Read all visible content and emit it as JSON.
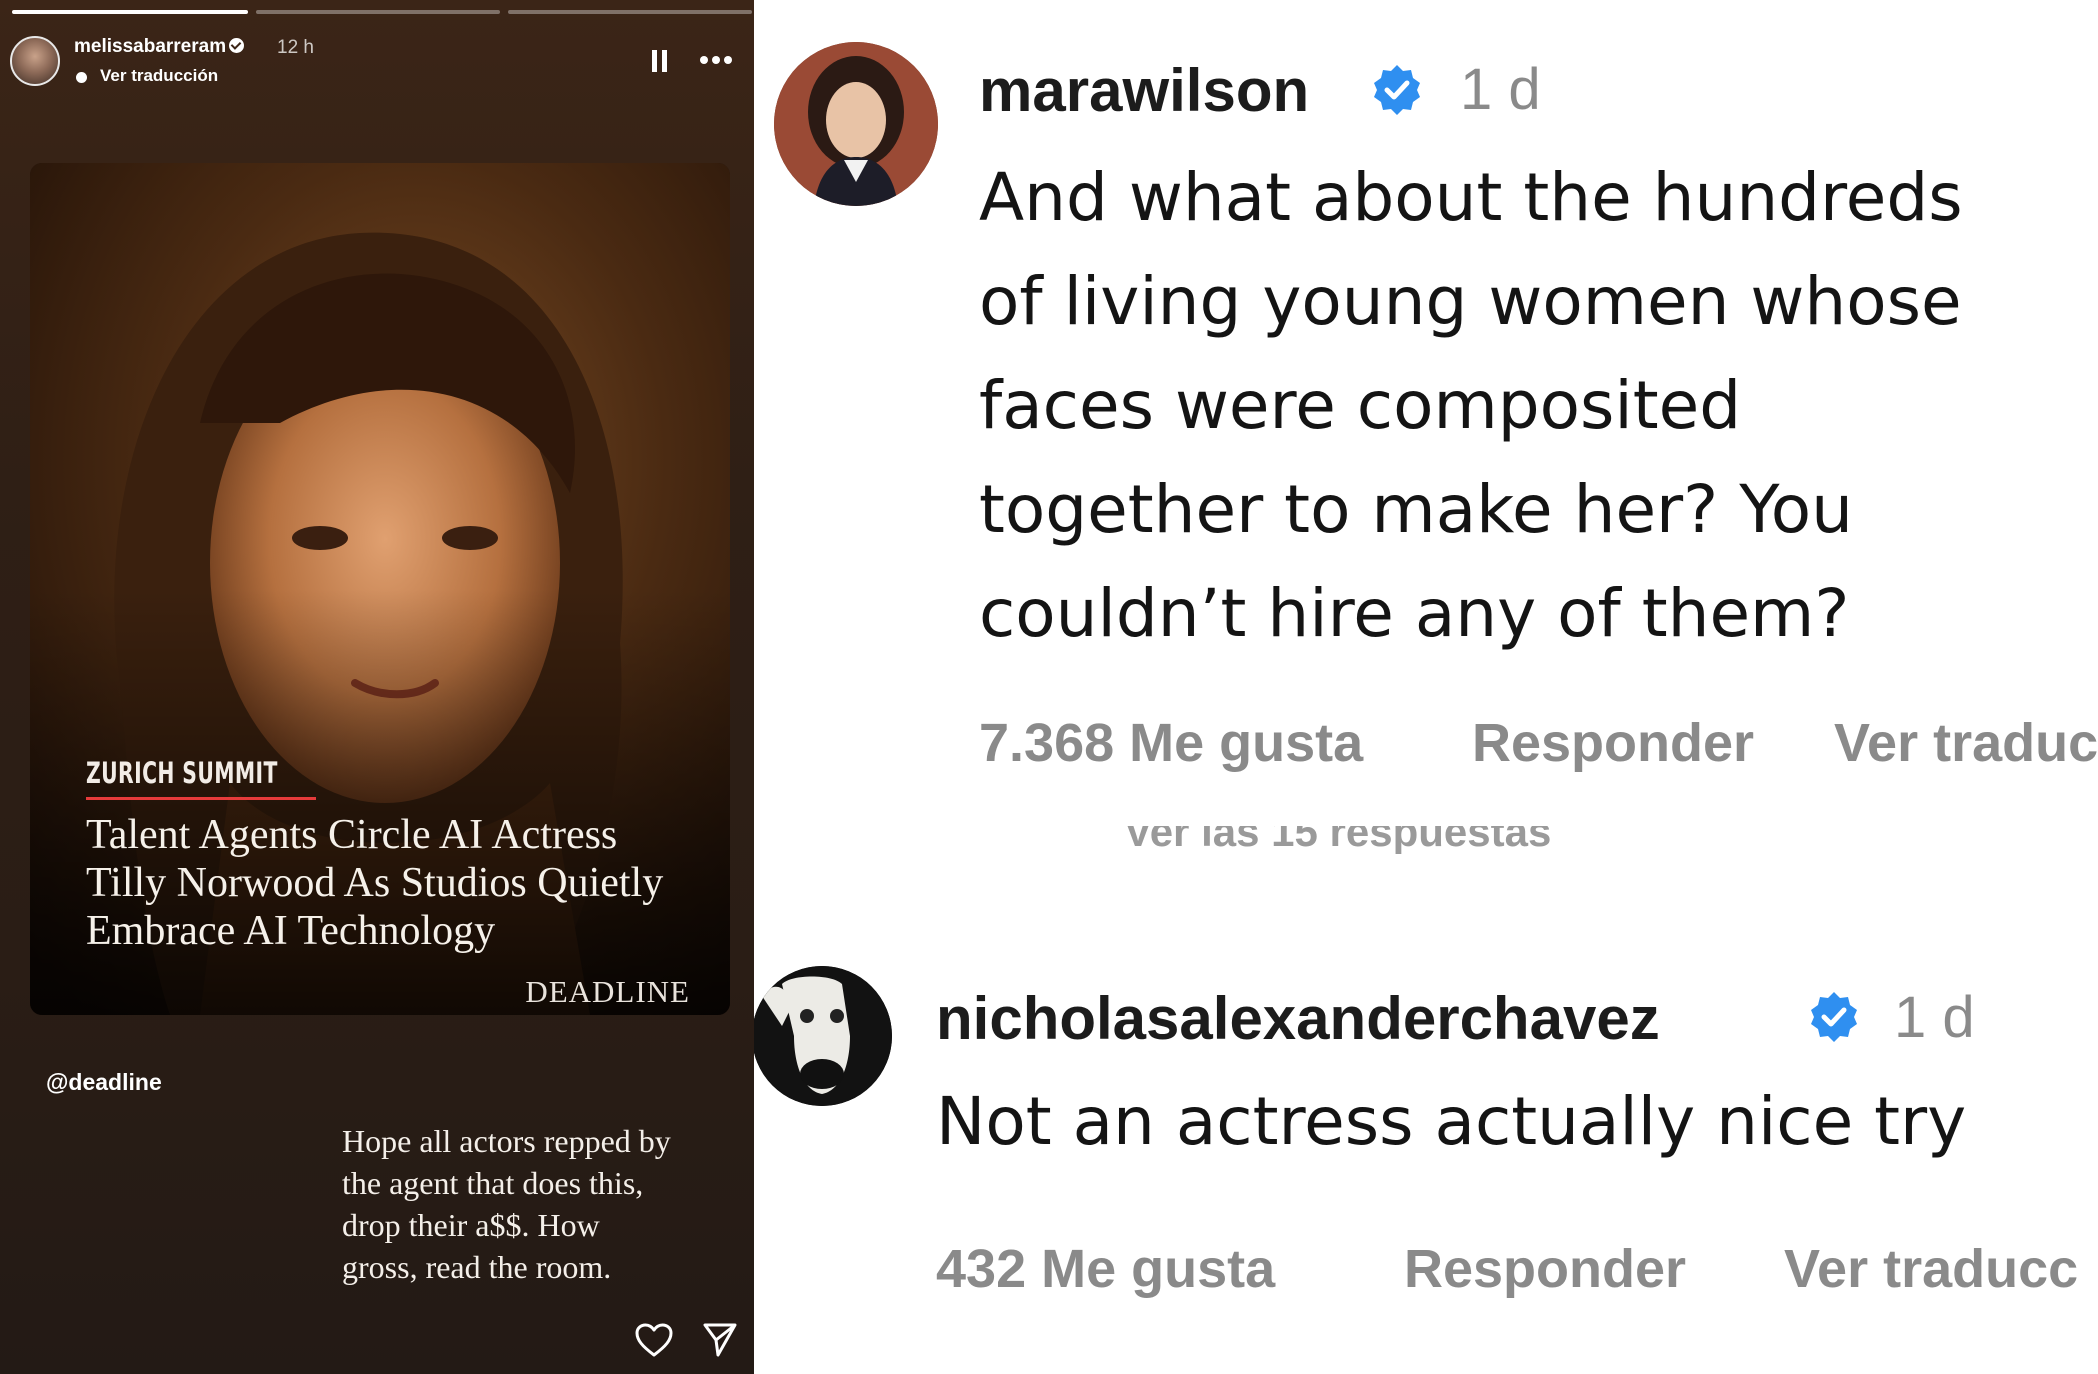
{
  "story": {
    "username": "melissabarreram",
    "time": "12 h",
    "translate_label": "Ver traducción",
    "progress_segments": 3,
    "article": {
      "kicker": "ZURICH SUMMIT",
      "headline_lines": [
        "Talent Agents Circle AI Actress",
        "Tilly Norwood As Studios Quietly",
        "Embrace AI Technology"
      ],
      "source": "DEADLINE"
    },
    "mention": "@deadline",
    "caption_lines": [
      "Hope all actors repped by",
      "the agent that does this,",
      "drop their a$$. How",
      "gross, read the room."
    ],
    "icons": {
      "pause": "pause-icon",
      "more": "more-icon",
      "like": "heart-icon",
      "share": "send-icon"
    }
  },
  "comments": {
    "items": [
      {
        "username": "marawilson",
        "verified": true,
        "time": "1 d",
        "text_lines": [
          "And what about the hundreds",
          "of living young women whose",
          "faces were composited",
          "together to make her? You",
          "couldn’t hire any of them?"
        ],
        "likes": "7.368 Me gusta",
        "reply_label": "Responder",
        "translate_label": "Ver traduc"
      },
      {
        "username": "nicholasalexanderchavez",
        "verified": true,
        "time": "1 d",
        "text_lines": [
          "Not an actress actually nice try"
        ],
        "likes": "432 Me gusta",
        "reply_label": "Responder",
        "translate_label": "Ver traducc"
      }
    ],
    "replies_label": "Ver las 15 respuestas"
  },
  "colors": {
    "verified_blue": "#2f8ff0",
    "muted_text": "#8a8a8a",
    "kicker_rule": "#e63b3b"
  }
}
